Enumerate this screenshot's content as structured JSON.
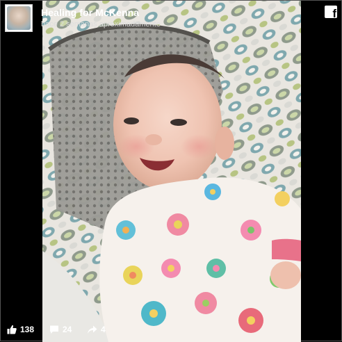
{
  "post": {
    "page_name": "Healing for McKenna",
    "timestamp": "hace 2 semanas aproximadamente"
  },
  "icons": {
    "brand": "facebook-icon",
    "like": "thumbs-up-icon",
    "comment": "comment-bubble-icon",
    "share": "share-arrow-icon"
  },
  "stats": {
    "likes": "138",
    "comments": "24",
    "shares": "4"
  },
  "colors": {
    "background": "#000000",
    "text": "#ffffff"
  }
}
